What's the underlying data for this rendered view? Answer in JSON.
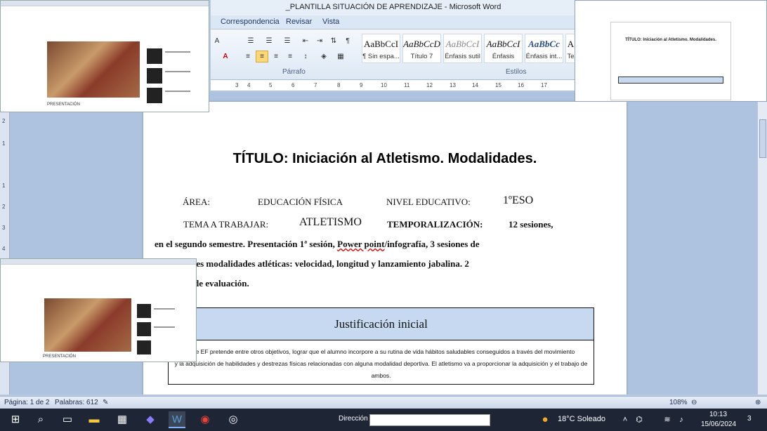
{
  "window": {
    "title": "_PLANTILLA SITUACIÓN DE APRENDIZAJE - Microsoft Word"
  },
  "ribbon": {
    "tabs": [
      "Correspondencia",
      "Revisar",
      "Vista"
    ],
    "group_parrafo": "Párrafo",
    "group_estilos": "Estilos",
    "styles": [
      {
        "preview": "AaBbCcI",
        "name": "¶ Sin espa..."
      },
      {
        "preview": "AaBbCcD",
        "name": "Título 7"
      },
      {
        "preview": "AaBbCcI",
        "name": "Énfasis sutil"
      },
      {
        "preview": "AaBbCcI",
        "name": "Énfasis"
      },
      {
        "preview": "AaBbCc",
        "name": "Énfasis int..."
      },
      {
        "preview": "A",
        "name": "Te"
      }
    ],
    "ruler_marks": [
      "3",
      "4",
      "5",
      "6",
      "7",
      "8",
      "9",
      "10",
      "11",
      "12",
      "13",
      "14",
      "15",
      "16",
      "17"
    ]
  },
  "document": {
    "title": "TÍTULO: Iniciación al Atletismo.  Modalidades.",
    "area_label": "ÁREA:",
    "area_value": "EDUCACIÓN FÍSICA",
    "nivel_label": "NIVEL EDUCATIVO:",
    "nivel_value": "1ºESO",
    "tema_label": "TEMA A TRABAJAR:",
    "tema_value": "ATLETISMO",
    "temp_label": "TEMPORALIZACIÓN:",
    "temp_value": "12 sesiones,",
    "line3_a": "en el segundo  semestre. Presentación  1ª sesión, ",
    "line3_b": "Power point",
    "line3_c": "/infografía,  3 sesiones de",
    "line4": "entes modalidades  atléticas: velocidad, longitud  y lanzamiento  jabalina.  2",
    "line5": "de evaluación.",
    "justificacion_title": "Justificación inicial",
    "justificacion_line1": "a de EF pretende entre otros objetivos, lograr que el alumno incorpore a su rutina de vida hábitos saludables conseguidos a través del movimiento",
    "justificacion_line2": "y la adquisición de habilidades y destrezas físicas relacionadas con alguna modalidad deportiva. El atletismo va a proporcionar la adquisición y el trabajo de",
    "justificacion_line3": "ambos."
  },
  "statusbar": {
    "page": "Página: 1 de 2",
    "words": "Palabras: 612",
    "zoom": "108%"
  },
  "taskbar": {
    "address_label": "Dirección",
    "weather": "18°C  Soleado",
    "time": "10:13",
    "date": "15/06/2024",
    "notification_count": "3"
  },
  "thumbnails": {
    "word_title": "TÍTULO: Iniciación al Atletismo.  Modalidades.",
    "browser_caption": "PRESENTACIÓN"
  }
}
